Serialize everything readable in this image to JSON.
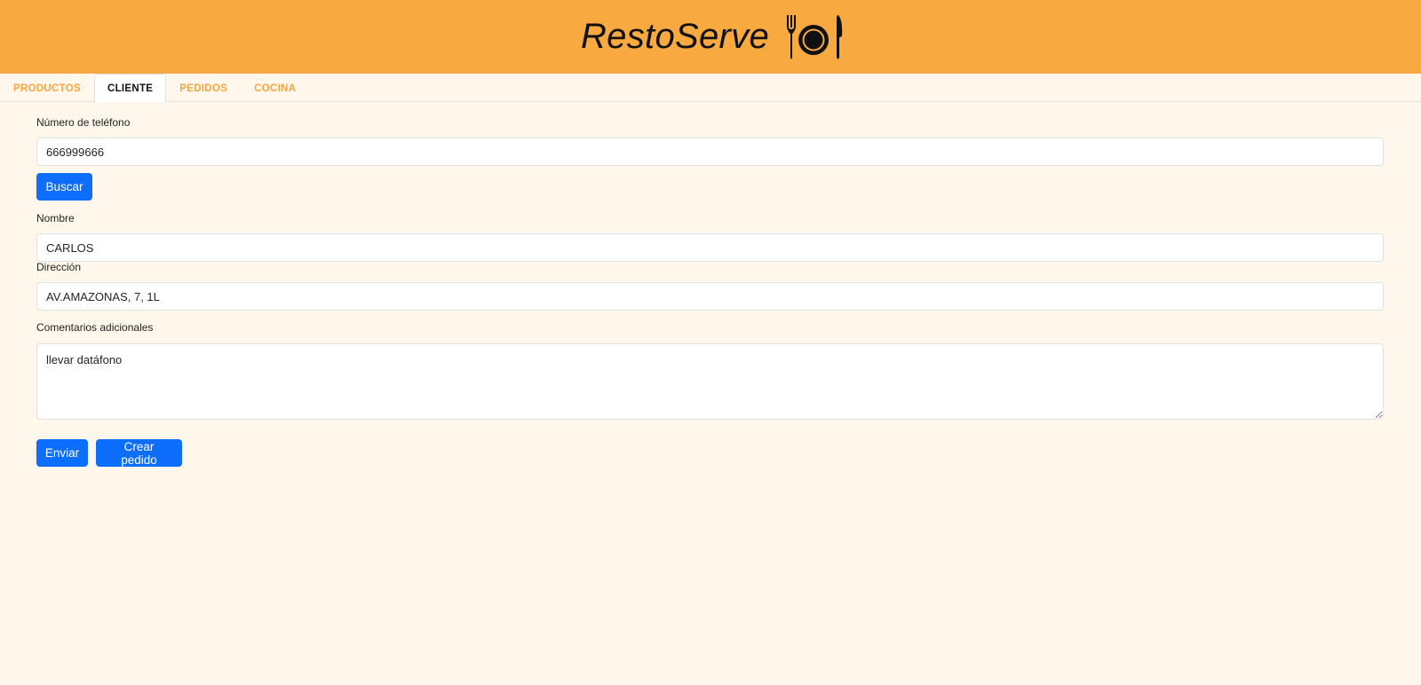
{
  "app": {
    "title": "RestoServe",
    "logo_icon": "cutlery-plate-icon",
    "header_color": "#f8a940",
    "background_color": "#fff7ec",
    "accent": "#0d6efd"
  },
  "tabs": [
    {
      "label": "PRODUCTOS",
      "active": false
    },
    {
      "label": "CLIENTE",
      "active": true
    },
    {
      "label": "PEDIDOS",
      "active": false
    },
    {
      "label": "COCINA",
      "active": false
    }
  ],
  "form": {
    "phone": {
      "label": "Número de teléfono",
      "value": "666999666"
    },
    "search_button": "Buscar",
    "name": {
      "label": "Nombre",
      "value": "CARLOS"
    },
    "address": {
      "label": "Dirección",
      "value": "AV.AMAZONAS, 7, 1L"
    },
    "comments": {
      "label": "Comentarios adicionales",
      "value": "llevar datáfono"
    },
    "send_button": "Enviar",
    "create_order_button": "Crear pedido"
  }
}
